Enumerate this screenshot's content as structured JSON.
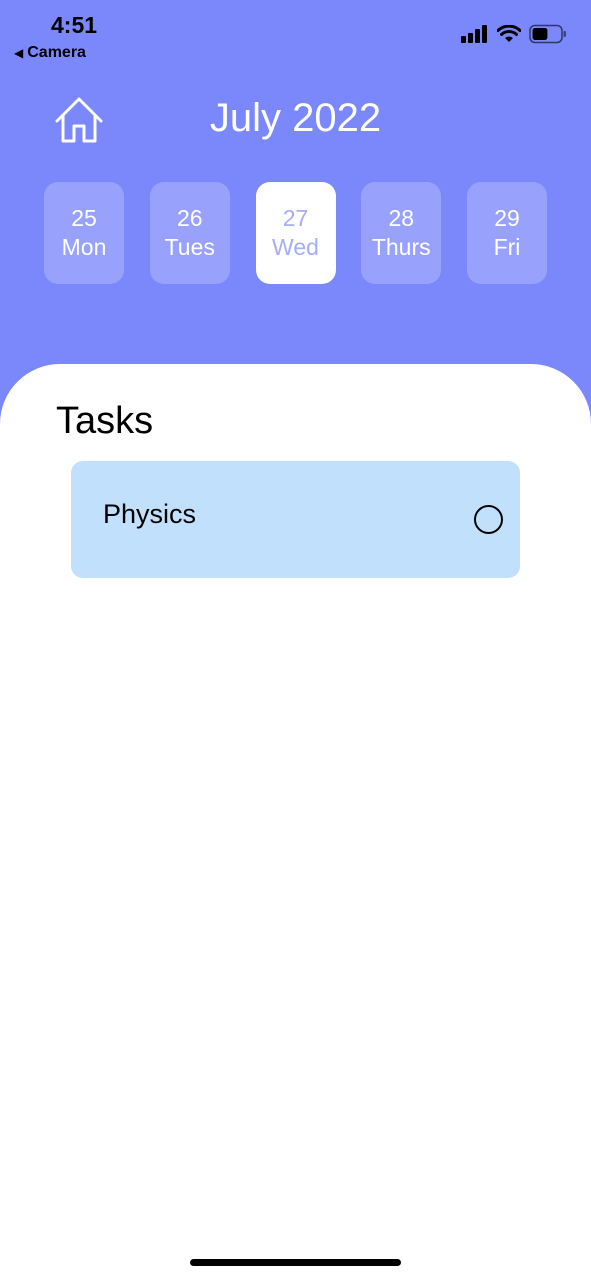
{
  "status_bar": {
    "time": "4:51",
    "back_app": "Camera",
    "signal_icon": "cellular-signal-icon",
    "wifi_icon": "wifi-icon",
    "battery_icon": "battery-icon",
    "battery_level": 0.55
  },
  "header": {
    "home_icon": "home-icon",
    "month_title": "July 2022"
  },
  "days": [
    {
      "date": "25",
      "weekday": "Mon",
      "selected": false
    },
    {
      "date": "26",
      "weekday": "Tues",
      "selected": false
    },
    {
      "date": "27",
      "weekday": "Wed",
      "selected": true
    },
    {
      "date": "28",
      "weekday": "Thurs",
      "selected": false
    },
    {
      "date": "29",
      "weekday": "Fri",
      "selected": false
    }
  ],
  "tasks": {
    "title": "Tasks",
    "items": [
      {
        "name": "Physics",
        "completed": false
      }
    ]
  },
  "colors": {
    "header_bg": "#7b88fb",
    "selected_day_text": "#a5adf3",
    "task_card_bg": "#c1e0fb"
  }
}
